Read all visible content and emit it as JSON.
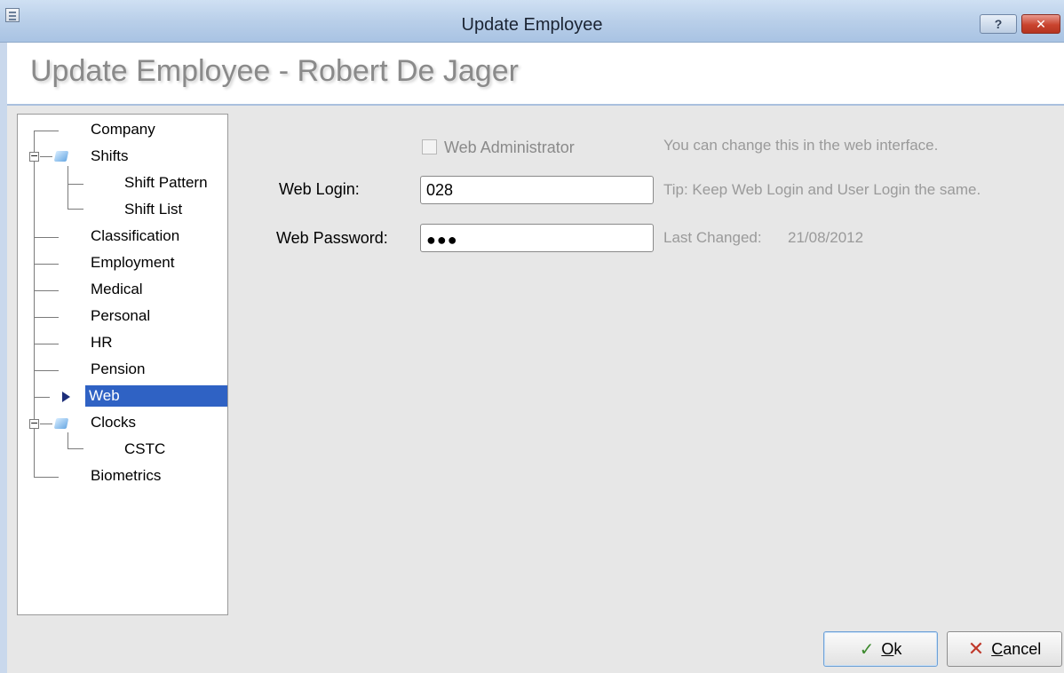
{
  "window": {
    "title": "Update Employee",
    "help_glyph": "?",
    "close_glyph": "✕"
  },
  "header": {
    "title": "Update Employee - Robert De Jager"
  },
  "tree": {
    "items": [
      {
        "label": "Company"
      },
      {
        "label": "Shifts"
      },
      {
        "label": "Shift Pattern"
      },
      {
        "label": "Shift List"
      },
      {
        "label": "Classification"
      },
      {
        "label": "Employment"
      },
      {
        "label": "Medical"
      },
      {
        "label": "Personal"
      },
      {
        "label": "HR"
      },
      {
        "label": "Pension"
      },
      {
        "label": "Web",
        "selected": true
      },
      {
        "label": "Clocks"
      },
      {
        "label": "CSTC"
      },
      {
        "label": "Biometrics"
      }
    ],
    "selected_color": "#2f62c4"
  },
  "form": {
    "web_admin_label": "Web Administrator",
    "web_admin_checked": false,
    "web_admin_hint": "You can change this in the web interface.",
    "web_login_label": "Web Login:",
    "web_login_value": "028",
    "web_login_hint": "Tip: Keep Web Login and User Login the same.",
    "web_password_label": "Web Password:",
    "web_password_mask": "●●●",
    "last_changed_label": "Last Changed:",
    "last_changed_value": "21/08/2012"
  },
  "buttons": {
    "ok_icon": "✓",
    "ok_label": "Ok",
    "ok_mnemonic": "O",
    "ok_rest": "k",
    "cancel_icon": "✕",
    "cancel_mnemonic": "C",
    "cancel_rest": "ancel"
  }
}
